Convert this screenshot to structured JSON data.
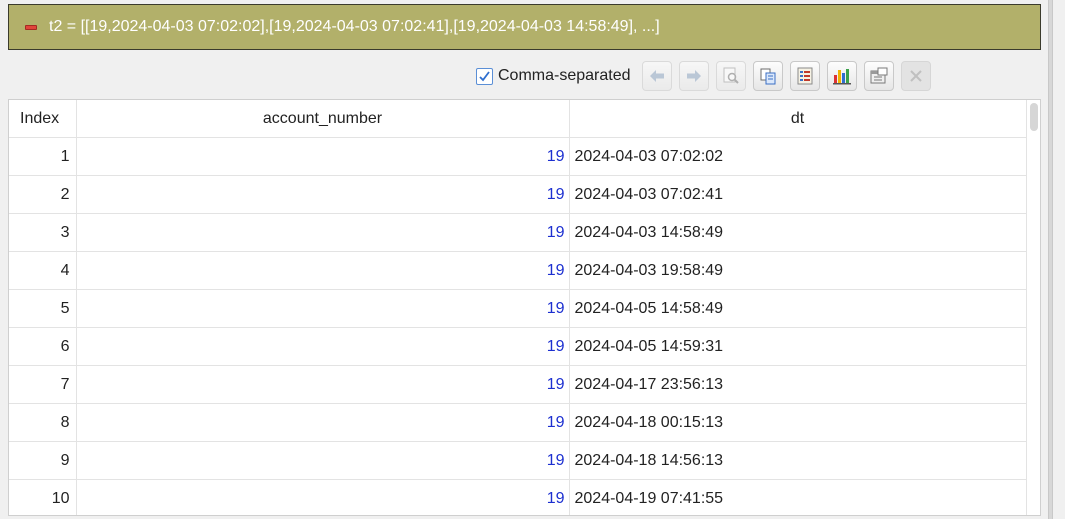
{
  "header": {
    "title": "t2 = [[19,2024-04-03 07:02:02],[19,2024-04-03 07:02:41],[19,2024-04-03 14:58:49], ...]",
    "collapse_icon": "minus-icon",
    "color": "#b2b06a"
  },
  "toolbar": {
    "comma_separated": {
      "label": "Comma-separated",
      "checked": true
    },
    "buttons": [
      {
        "name": "back-button",
        "icon": "arrow-left-icon",
        "enabled": false
      },
      {
        "name": "forward-button",
        "icon": "arrow-right-icon",
        "enabled": false
      },
      {
        "name": "preview-button",
        "icon": "magnifier-document-icon",
        "enabled": false
      },
      {
        "name": "copy-button",
        "icon": "copy-icon",
        "enabled": true
      },
      {
        "name": "list-view-button",
        "icon": "list-icon",
        "enabled": true
      },
      {
        "name": "chart-button",
        "icon": "bar-chart-icon",
        "enabled": true
      },
      {
        "name": "properties-button",
        "icon": "properties-icon",
        "enabled": true
      },
      {
        "name": "close-button",
        "icon": "close-icon",
        "enabled": false
      }
    ]
  },
  "table": {
    "columns": [
      "Index",
      "account_number",
      "dt"
    ],
    "rows": [
      {
        "index": "1",
        "account_number": "19",
        "dt": "2024-04-03 07:02:02"
      },
      {
        "index": "2",
        "account_number": "19",
        "dt": "2024-04-03 07:02:41"
      },
      {
        "index": "3",
        "account_number": "19",
        "dt": "2024-04-03 14:58:49"
      },
      {
        "index": "4",
        "account_number": "19",
        "dt": "2024-04-03 19:58:49"
      },
      {
        "index": "5",
        "account_number": "19",
        "dt": "2024-04-05 14:58:49"
      },
      {
        "index": "6",
        "account_number": "19",
        "dt": "2024-04-05 14:59:31"
      },
      {
        "index": "7",
        "account_number": "19",
        "dt": "2024-04-17 23:56:13"
      },
      {
        "index": "8",
        "account_number": "19",
        "dt": "2024-04-18 00:15:13"
      },
      {
        "index": "9",
        "account_number": "19",
        "dt": "2024-04-18 14:56:13"
      },
      {
        "index": "10",
        "account_number": "19",
        "dt": "2024-04-19 07:41:55"
      }
    ]
  },
  "colors": {
    "number_text": "#1c2fd0",
    "checkbox_accent": "#5b8fd6"
  }
}
